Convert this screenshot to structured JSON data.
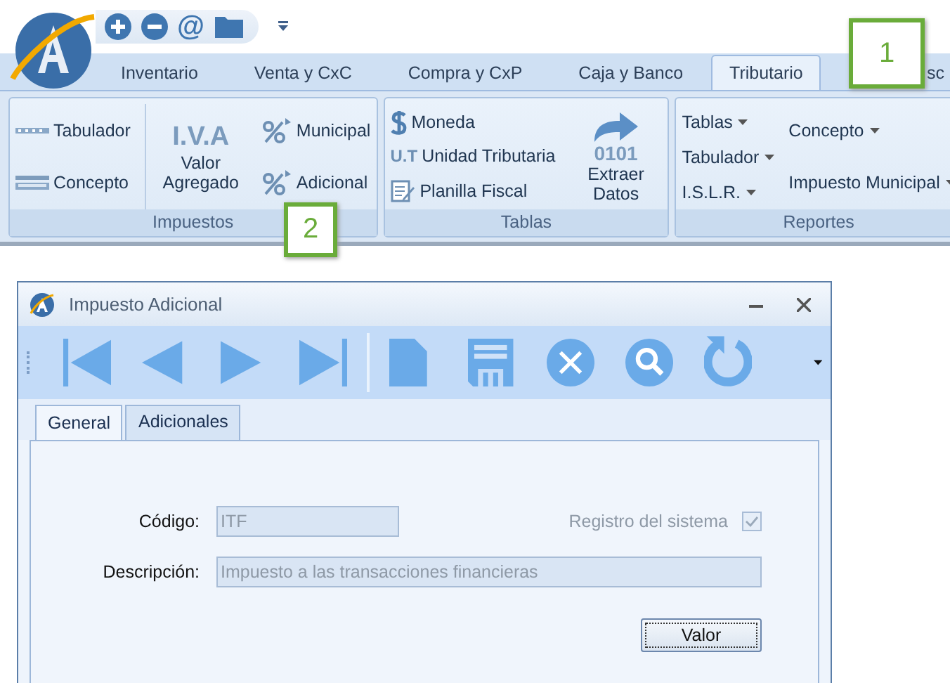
{
  "quick_access": [
    {
      "kind": "plus"
    },
    {
      "kind": "minus"
    },
    {
      "kind": "text",
      "label": "@"
    },
    {
      "kind": "folder"
    }
  ],
  "ribbon_tabs": [
    {
      "label": "Inventario",
      "selected": false
    },
    {
      "label": "Venta y CxC",
      "selected": false
    },
    {
      "label": "Compra y CxP",
      "selected": false
    },
    {
      "label": "Caja y Banco",
      "selected": false
    },
    {
      "label": "Tributario",
      "selected": true
    },
    {
      "label": "sc",
      "selected": false
    }
  ],
  "groups": [
    {
      "title": "Impuestos",
      "columns": [
        [
          {
            "kind": "small",
            "label": "Tabulador"
          },
          {
            "kind": "small",
            "label": "Concepto"
          }
        ],
        [
          {
            "kind": "large",
            "icon_text": "I.V.A",
            "label": "Valor Agregado"
          }
        ],
        [
          {
            "kind": "small",
            "label": "Municipal"
          },
          {
            "kind": "small",
            "label": "Adicional"
          }
        ]
      ]
    },
    {
      "title": "Tablas",
      "columns": [
        [
          {
            "kind": "small",
            "label": "Moneda"
          },
          {
            "kind": "small",
            "icon_text": "U.T",
            "label": "Unidad Tributaria"
          },
          {
            "kind": "small",
            "label": "Planilla Fiscal"
          }
        ],
        [
          {
            "kind": "large",
            "icon_text": "0101",
            "label": "Extraer Datos"
          }
        ]
      ]
    },
    {
      "title": "Reportes",
      "columns": [
        [
          {
            "kind": "menu",
            "label": "Tablas"
          },
          {
            "kind": "menu",
            "label": "Tabulador"
          },
          {
            "kind": "menu",
            "label": "I.S.L.R."
          }
        ],
        [
          {
            "kind": "menu",
            "label": "Concepto"
          },
          {
            "kind": "menu",
            "label": "Impuesto Municipal"
          }
        ]
      ]
    }
  ],
  "callouts": [
    {
      "label": "1"
    },
    {
      "label": "2"
    }
  ],
  "dialog": {
    "title": "Impuesto Adicional",
    "toolbar": [
      {
        "kind": "first"
      },
      {
        "kind": "prev"
      },
      {
        "kind": "next"
      },
      {
        "kind": "last"
      },
      {
        "kind": "separator"
      },
      {
        "kind": "new"
      },
      {
        "kind": "save"
      },
      {
        "kind": "cancel"
      },
      {
        "kind": "search"
      },
      {
        "kind": "refresh"
      }
    ],
    "tabs": [
      {
        "label": "General",
        "selected": true
      },
      {
        "label": "Adicionales",
        "selected": false
      }
    ],
    "codigo": {
      "label": "Código:",
      "value": "ITF",
      "disabled": true
    },
    "registro": {
      "label": "Registro del sistema",
      "checked": true,
      "disabled": true
    },
    "descripcion": {
      "label": "Descripción:",
      "value": "Impuesto a las transacciones financieras",
      "disabled": true
    },
    "button": "Valor"
  }
}
